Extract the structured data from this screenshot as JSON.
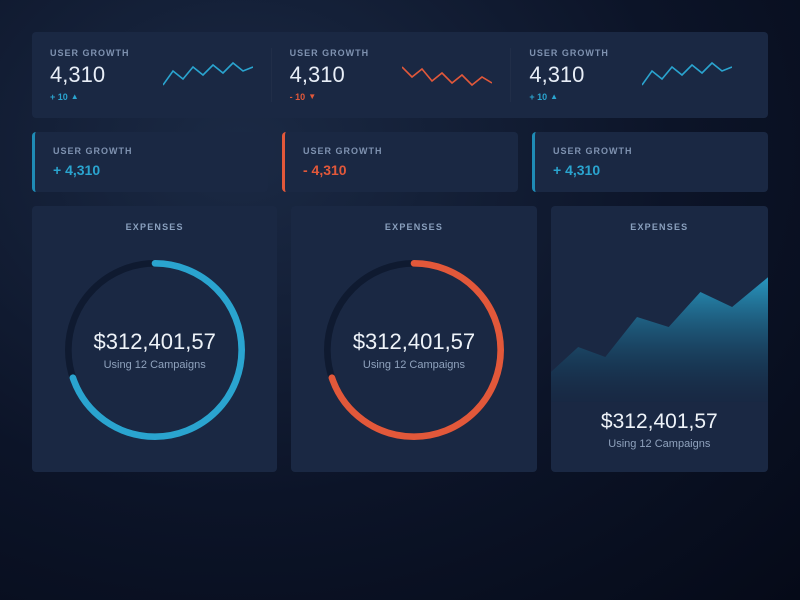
{
  "colors": {
    "blue": "#2aa4cf",
    "red": "#e2583a",
    "track": "#0f1a30"
  },
  "top": [
    {
      "label": "USER GROWTH",
      "value": "4,310",
      "delta_text": "+ 10",
      "direction": "up",
      "spark_color": "#2aa4cf"
    },
    {
      "label": "USER GROWTH",
      "value": "4,310",
      "delta_text": "- 10",
      "direction": "down",
      "spark_color": "#e2583a"
    },
    {
      "label": "USER GROWTH",
      "value": "4,310",
      "delta_text": "+ 10",
      "direction": "up",
      "spark_color": "#2aa4cf"
    }
  ],
  "mid": [
    {
      "label": "USER GROWTH",
      "value": "+ 4,310",
      "accent": "blue"
    },
    {
      "label": "USER GROWTH",
      "value": "- 4,310",
      "accent": "red"
    },
    {
      "label": "USER GROWTH",
      "value": "+ 4,310",
      "accent": "blue"
    }
  ],
  "expenses": {
    "title": "EXPENSES",
    "amount": "$312,401,57",
    "sub": "Using 12 Campaigns",
    "donut_pct": 70
  },
  "chart_data": [
    {
      "type": "line",
      "title": "USER GROWTH",
      "values": [
        5,
        9,
        7,
        10,
        8,
        11,
        9,
        12,
        10,
        11
      ],
      "color": "#2aa4cf"
    },
    {
      "type": "line",
      "title": "USER GROWTH",
      "values": [
        10,
        7,
        9,
        6,
        8,
        5,
        7,
        4,
        6,
        5
      ],
      "color": "#e2583a"
    },
    {
      "type": "line",
      "title": "USER GROWTH",
      "values": [
        5,
        9,
        7,
        10,
        8,
        11,
        9,
        12,
        10,
        11
      ],
      "color": "#2aa4cf"
    },
    {
      "type": "pie",
      "title": "EXPENSES",
      "values": [
        70,
        30
      ],
      "color": "#2aa4cf"
    },
    {
      "type": "pie",
      "title": "EXPENSES",
      "values": [
        70,
        30
      ],
      "color": "#e2583a"
    },
    {
      "type": "area",
      "title": "EXPENSES",
      "values": [
        20,
        35,
        30,
        55,
        50,
        72,
        65,
        80
      ],
      "color": "#1f8bb5"
    }
  ]
}
